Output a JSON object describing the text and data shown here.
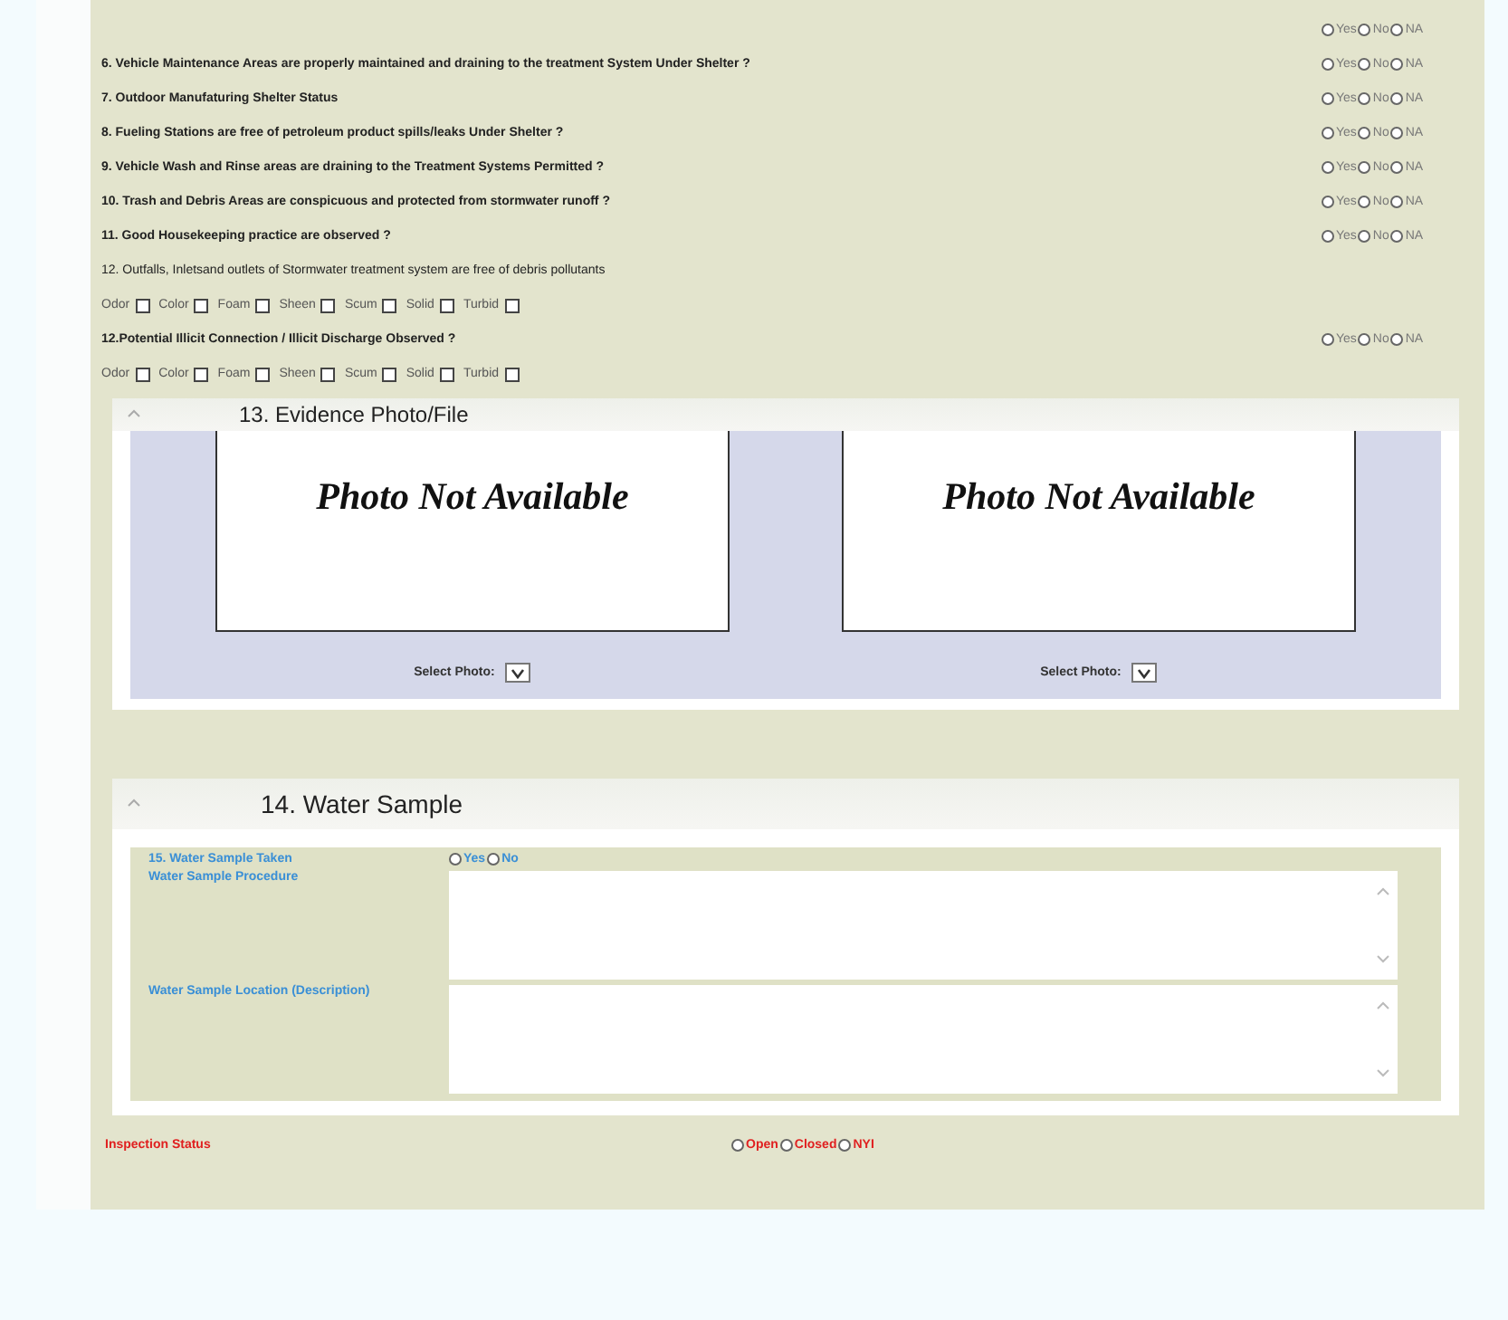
{
  "checklist": [
    {
      "kind": "radio",
      "options": [
        {
          "label": "Yes",
          "selected": false
        },
        {
          "label": "No",
          "selected": false
        },
        {
          "label": "NA",
          "selected": false
        }
      ]
    },
    {
      "kind": "radio",
      "bold": true,
      "text": "6. Vehicle Maintenance Areas are properly maintained and draining to the treatment System Under Shelter ?",
      "options": [
        {
          "label": "Yes",
          "selected": false
        },
        {
          "label": "No",
          "selected": false
        },
        {
          "label": "NA",
          "selected": false
        }
      ]
    },
    {
      "kind": "radio",
      "bold": true,
      "text": "7. Outdoor Manufaturing Shelter Status",
      "options": [
        {
          "label": "Yes",
          "selected": false
        },
        {
          "label": "No",
          "selected": false
        },
        {
          "label": "NA",
          "selected": false
        }
      ]
    },
    {
      "kind": "radio",
      "bold": true,
      "text": "8. Fueling Stations are free of petroleum product spills/leaks Under Shelter ?",
      "options": [
        {
          "label": "Yes",
          "selected": false
        },
        {
          "label": "No",
          "selected": false
        },
        {
          "label": "NA",
          "selected": false
        }
      ]
    },
    {
      "kind": "radio",
      "bold": true,
      "text": "9. Vehicle Wash and Rinse areas are draining to the Treatment Systems Permitted ?",
      "options": [
        {
          "label": "Yes",
          "selected": false
        },
        {
          "label": "No",
          "selected": false
        },
        {
          "label": "NA",
          "selected": false
        }
      ]
    },
    {
      "kind": "radio",
      "bold": true,
      "text": "10. Trash and Debris Areas are conspicuous and protected from stormwater runoff ?",
      "options": [
        {
          "label": "Yes",
          "selected": false
        },
        {
          "label": "No",
          "selected": false
        },
        {
          "label": "NA",
          "selected": false
        }
      ]
    },
    {
      "kind": "radio",
      "bold": true,
      "text": "11. Good Housekeeping practice are observed ?",
      "options": [
        {
          "label": "Yes",
          "selected": false
        },
        {
          "label": "No",
          "selected": false
        },
        {
          "label": "NA",
          "selected": false
        }
      ]
    },
    {
      "kind": "radio",
      "bold": false,
      "text": "12. Outfalls, Inletsand outlets of Stormwater treatment system are free of debris pollutants"
    },
    {
      "kind": "checks",
      "checks": [
        {
          "label": "Odor",
          "checked": false
        },
        {
          "label": "Color",
          "checked": false
        },
        {
          "label": "Foam",
          "checked": false
        },
        {
          "label": "Sheen",
          "checked": false
        },
        {
          "label": "Scum",
          "checked": false
        },
        {
          "label": "Solid",
          "checked": false
        },
        {
          "label": "Turbid",
          "checked": false
        }
      ]
    },
    {
      "kind": "radio",
      "bold": true,
      "text": "12.Potential Illicit Connection / Illicit Discharge Observed ?",
      "options": [
        {
          "label": "Yes",
          "selected": false
        },
        {
          "label": "No",
          "selected": false
        },
        {
          "label": "NA",
          "selected": false
        }
      ]
    },
    {
      "kind": "checks",
      "checks": [
        {
          "label": "Odor",
          "checked": false
        },
        {
          "label": "Color",
          "checked": false
        },
        {
          "label": "Foam",
          "checked": false
        },
        {
          "label": "Sheen",
          "checked": false
        },
        {
          "label": "Scum",
          "checked": false
        },
        {
          "label": "Solid",
          "checked": false
        },
        {
          "label": "Turbid",
          "checked": false
        }
      ]
    }
  ],
  "evidence": {
    "title": "13. Evidence Photo/File",
    "photos": [
      {
        "placeholder_text": "Photo Not Available",
        "select_label": "Select Photo:"
      },
      {
        "placeholder_text": "Photo Not Available",
        "select_label": "Select Photo:"
      }
    ]
  },
  "water_sample": {
    "title": "14. Water Sample",
    "taken": {
      "label": "15. Water Sample Taken",
      "options": [
        {
          "label": "Yes",
          "selected": false
        },
        {
          "label": "No",
          "selected": false
        }
      ]
    },
    "fields": [
      {
        "label": "Water Sample Procedure"
      },
      {
        "label": "Water Sample Location (Description)"
      }
    ]
  },
  "inspection_status": {
    "label": "Inspection Status",
    "options": [
      {
        "label": "Open",
        "selected": false
      },
      {
        "label": "Closed",
        "selected": false
      },
      {
        "label": "NYI",
        "selected": false
      }
    ]
  }
}
